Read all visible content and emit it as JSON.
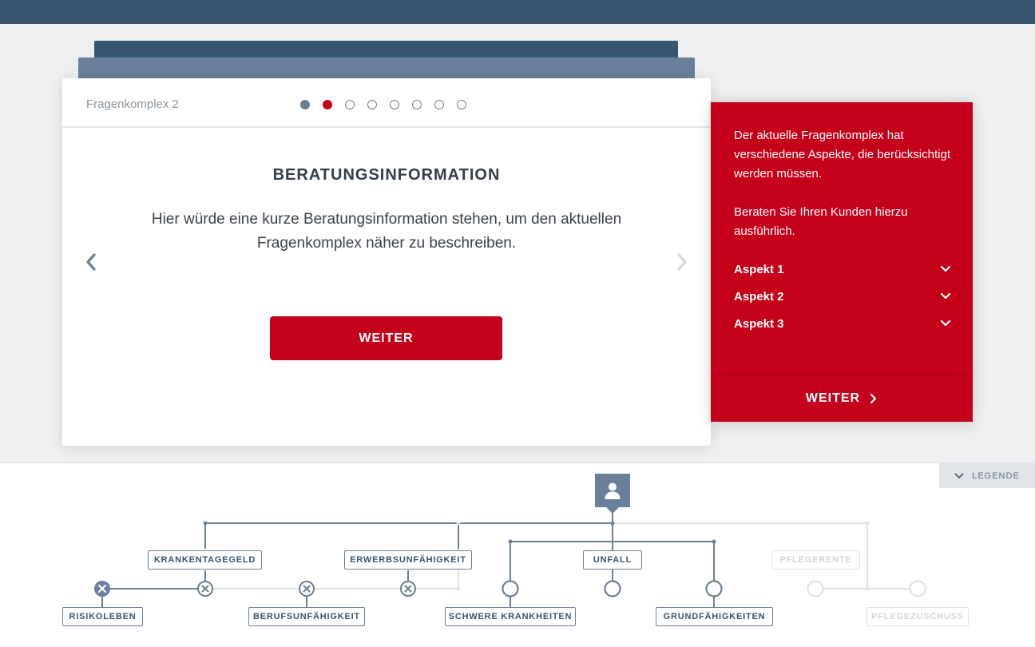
{
  "card": {
    "label": "Fragenkomplex 2",
    "title": "BERATUNGSINFORMATION",
    "text": "Hier würde eine kurze Beratungsinformation stehen, um den aktuellen Fragenkomplex näher zu beschreiben.",
    "button": "WEITER",
    "steps": {
      "total": 8,
      "current": 2
    }
  },
  "side": {
    "paragraph1": "Der aktuelle Fragenkomplex hat verschiedene Aspekte, die berücksichtigt werden müssen.",
    "paragraph2": "Beraten Sie Ihren Kunden hierzu ausführlich.",
    "aspects": [
      "Aspekt 1",
      "Aspekt 2",
      "Aspekt 3"
    ],
    "button": "WEITER"
  },
  "legend": {
    "label": "LEGENDE"
  },
  "tree": {
    "labels": {
      "krankentagegeld": "KRANKENTAGEGELD",
      "erwerbsunfaehigkeit": "ERWERBSUNFÄHIGKEIT",
      "unfall": "UNFALL",
      "pflegerente": "PFLEGERENTE",
      "risikoleben": "RISIKOLEBEN",
      "berufsunfaehigkeit": "BERUFSUNFÄHIGKEIT",
      "schwere_krankheiten": "SCHWERE KRANKHEITEN",
      "grundfaehigkeiten": "GRUNDFÄHIGKEITEN",
      "pflegezuschuss": "PFLEGEZUSCHUSS"
    }
  },
  "colors": {
    "brand": "#c4001a",
    "navy": "#36566f",
    "slate": "#6a809a"
  }
}
